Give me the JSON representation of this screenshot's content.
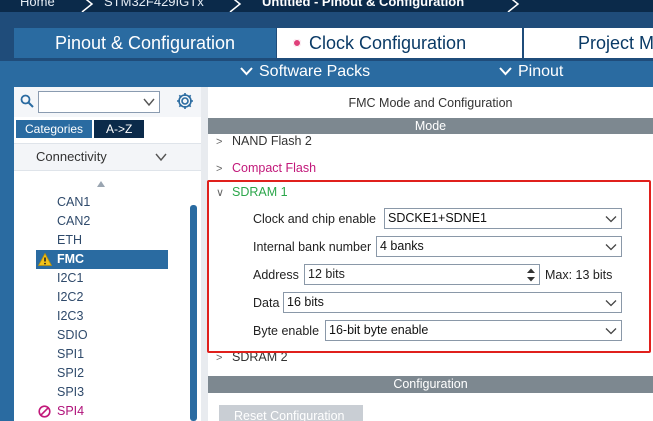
{
  "breadcrumb": {
    "items": [
      "Home",
      "STM32F429IGTx",
      "Untitled - Pinout & Configuration"
    ]
  },
  "tabs": {
    "pinout": "Pinout & Configuration",
    "clock": "Clock Configuration",
    "project": "Project Ma"
  },
  "subbar": {
    "software_packs": "Software Packs",
    "pinout": "Pinout"
  },
  "sidebar": {
    "search_value": "",
    "tab_categories": "Categories",
    "tab_az": "A->Z",
    "group": "Connectivity",
    "items": [
      {
        "label": "CAN1",
        "state": "normal"
      },
      {
        "label": "CAN2",
        "state": "normal"
      },
      {
        "label": "ETH",
        "state": "normal"
      },
      {
        "label": "FMC",
        "state": "selected-warning"
      },
      {
        "label": "I2C1",
        "state": "normal"
      },
      {
        "label": "I2C2",
        "state": "normal"
      },
      {
        "label": "I2C3",
        "state": "normal"
      },
      {
        "label": "SDIO",
        "state": "normal"
      },
      {
        "label": "SPI1",
        "state": "normal"
      },
      {
        "label": "SPI2",
        "state": "normal"
      },
      {
        "label": "SPI3",
        "state": "normal"
      },
      {
        "label": "SPI4",
        "state": "error"
      }
    ]
  },
  "main": {
    "title": "FMC Mode and Configuration",
    "mode_header": "Mode",
    "tree": {
      "nand": "NAND Flash 2",
      "compact": "Compact Flash",
      "sdram1": "SDRAM 1",
      "sdram2": "SDRAM 2"
    },
    "fields": {
      "clock_enable_label": "Clock and chip enable",
      "clock_enable_value": "SDCKE1+SDNE1",
      "bank_label": "Internal bank number",
      "bank_value": "4 banks",
      "address_label": "Address",
      "address_value": "12 bits",
      "address_max": "Max: 13 bits",
      "data_label": "Data",
      "data_value": "16 bits",
      "byte_label": "Byte enable",
      "byte_value": "16-bit byte enable"
    },
    "config_header": "Configuration",
    "reset_button": "Reset Configuration"
  },
  "colors": {
    "accent": "#2a6ba1",
    "dark_navy": "#0b2a4a",
    "highlight_border": "#e0201c",
    "green": "#2ba64a",
    "pink": "#c2187a"
  }
}
